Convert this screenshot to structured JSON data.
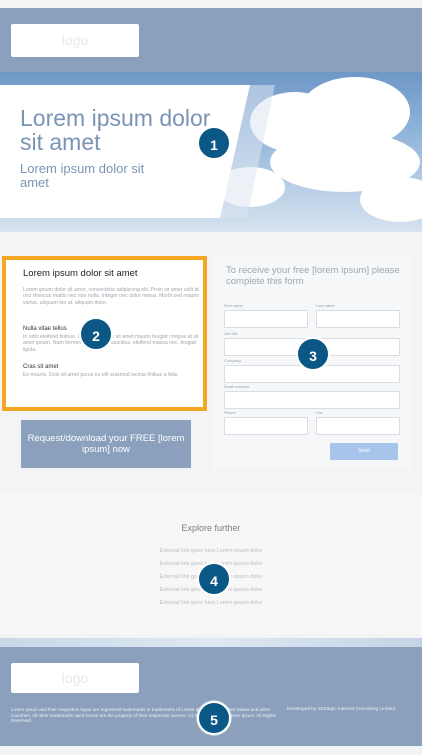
{
  "header": {
    "logo_text": "logo"
  },
  "hero": {
    "title": "Lorem ipsum dolor sit amet",
    "subtitle": "Lorem ipsum dolor sit amet"
  },
  "left": {
    "title": "Lorem ipsum dolor sit amet",
    "p1": "Lorem ipsum dolor sit amet, consectetur adipiscing elit. Proin sit amet velit at orci rhoncus mattis nec non nulla. Integer nec dolor metus. Morbi sed mauris varius, aliquam leo at, aliquam dolor.",
    "h2": "Nulla vitae tellus",
    "p2": "In odio eleifend finibus. Duis sodales ex sit amet mauris feugiat congue at sit amet ipsum. Nam fermentum quis est faucibus, eleifend massa nec, feugiat ligula.",
    "h3": "Cras sit amet",
    "p3": "Ex mauris. Duis sit amet purus eu elit euismod lacinia finibus a felis."
  },
  "cta": {
    "label": "Request/download your FREE [lorem ipsum] now"
  },
  "form": {
    "title": "To receive your free [lorem ipsum] please complete this form",
    "fields": {
      "first_name": "First name",
      "last_name": "Last name",
      "job_title": "Job title",
      "company": "Company",
      "email": "Email address",
      "phone": "Phone",
      "fax": "Fax"
    },
    "send_label": "Send"
  },
  "explore": {
    "title": "Explore further",
    "links": [
      "External link goes here Lorem ipsum dolor",
      "External link goes here Lorem ipsum dolor",
      "External link goes here Lorem ipsum dolor",
      "External link goes here Lorem ipsum dolor",
      "External link goes here Lorem ipsum dolor"
    ]
  },
  "footer": {
    "logo_text": "logo",
    "legal": "Lorem Ipsum and their respective logos are registered trademarks or trademarks of Lorem Ipsum in the United States and other countries. All other trademarks used herein are the property of their respective owners. (c) Copyright 2014 Lorem Ipsum. All Rights Reserved.",
    "developer": "Developed by Strategic Internet Consulting Limited"
  },
  "markers": [
    "1",
    "2",
    "3",
    "4",
    "5"
  ],
  "colors": {
    "header_bg": "#8aa0bc",
    "highlight_border": "#f5a623",
    "marker_bg": "#0b5785",
    "send_button": "#a7c5ea"
  }
}
